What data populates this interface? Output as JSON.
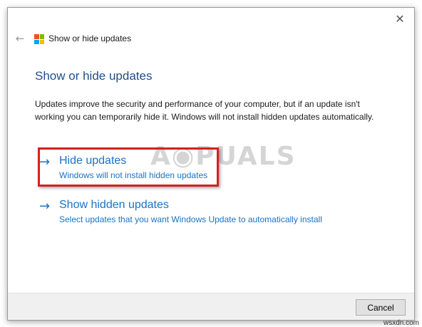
{
  "window": {
    "title": "Show or hide updates",
    "back_icon": "back-arrow-icon",
    "close_icon": "close-icon"
  },
  "main": {
    "heading": "Show or hide updates",
    "description": "Updates improve the security and performance of your computer, but if an update isn't working you can temporarily hide it. Windows will not install hidden updates automatically."
  },
  "options": [
    {
      "title": "Hide updates",
      "subtitle": "Windows will not install hidden updates",
      "icon": "arrow-right-icon"
    },
    {
      "title": "Show hidden updates",
      "subtitle": "Select updates that you want Windows Update to automatically install",
      "icon": "arrow-right-icon"
    }
  ],
  "footer": {
    "cancel_label": "Cancel"
  },
  "watermark": {
    "text": "APPUALS",
    "site": "wsxdn.com"
  },
  "colors": {
    "link": "#1a73c4",
    "heading": "#1e4e8c",
    "highlight": "#d42020"
  }
}
